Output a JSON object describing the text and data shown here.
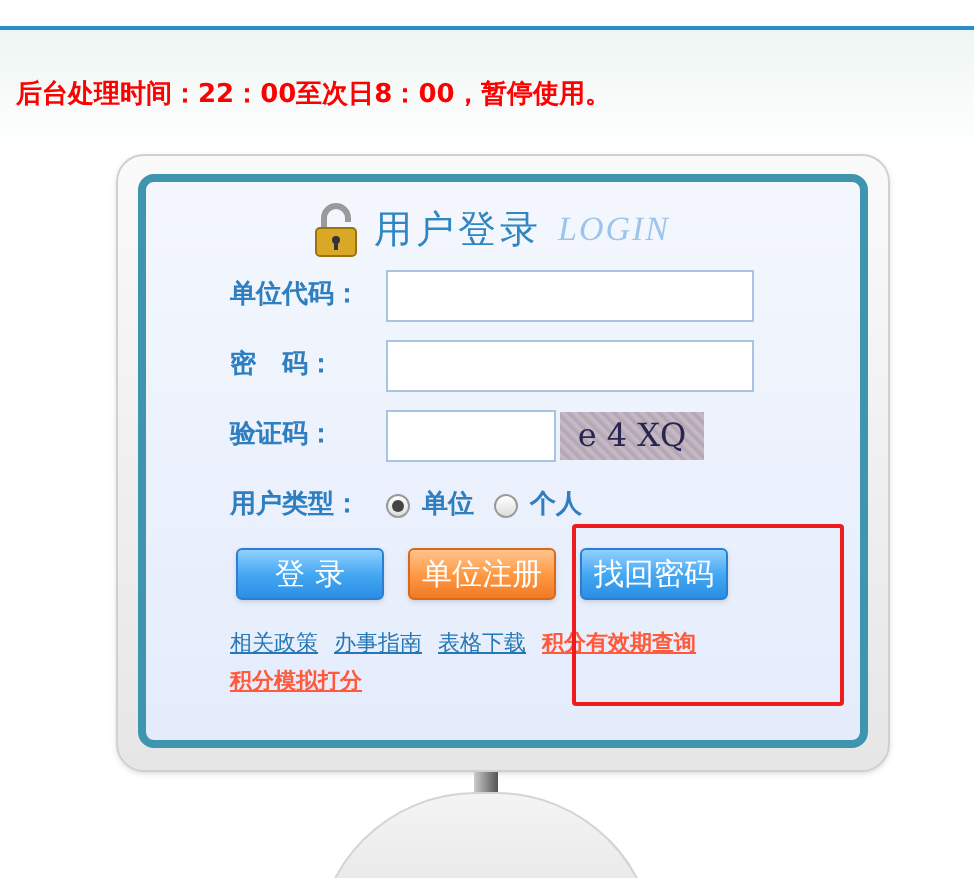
{
  "notice": "后台处理时间：22：00至次日8：00，暂停使用。",
  "login": {
    "title": "用户登录",
    "subtitle": "LOGIN",
    "fields": [
      {
        "label": "单位代码：",
        "kind": "text"
      },
      {
        "label": "密　码：",
        "kind": "password"
      },
      {
        "label": "验证码：",
        "kind": "captcha",
        "captcha": "e 4 XQ"
      }
    ],
    "user_type": {
      "label": "用户类型：",
      "options": [
        {
          "label": "单位",
          "selected": true
        },
        {
          "label": "个人",
          "selected": false
        }
      ]
    },
    "buttons": [
      {
        "label": "登 录",
        "kind": "blue"
      },
      {
        "label": "单位注册",
        "kind": "orange"
      },
      {
        "label": "找回密码",
        "kind": "blue"
      }
    ],
    "links": [
      {
        "label": "相关政策",
        "kind": "normal"
      },
      {
        "label": "办事指南",
        "kind": "normal"
      },
      {
        "label": "表格下载",
        "kind": "normal"
      },
      {
        "label": "积分有效期查询",
        "kind": "highlight"
      },
      {
        "label": "积分模拟打分",
        "kind": "highlight"
      }
    ]
  }
}
